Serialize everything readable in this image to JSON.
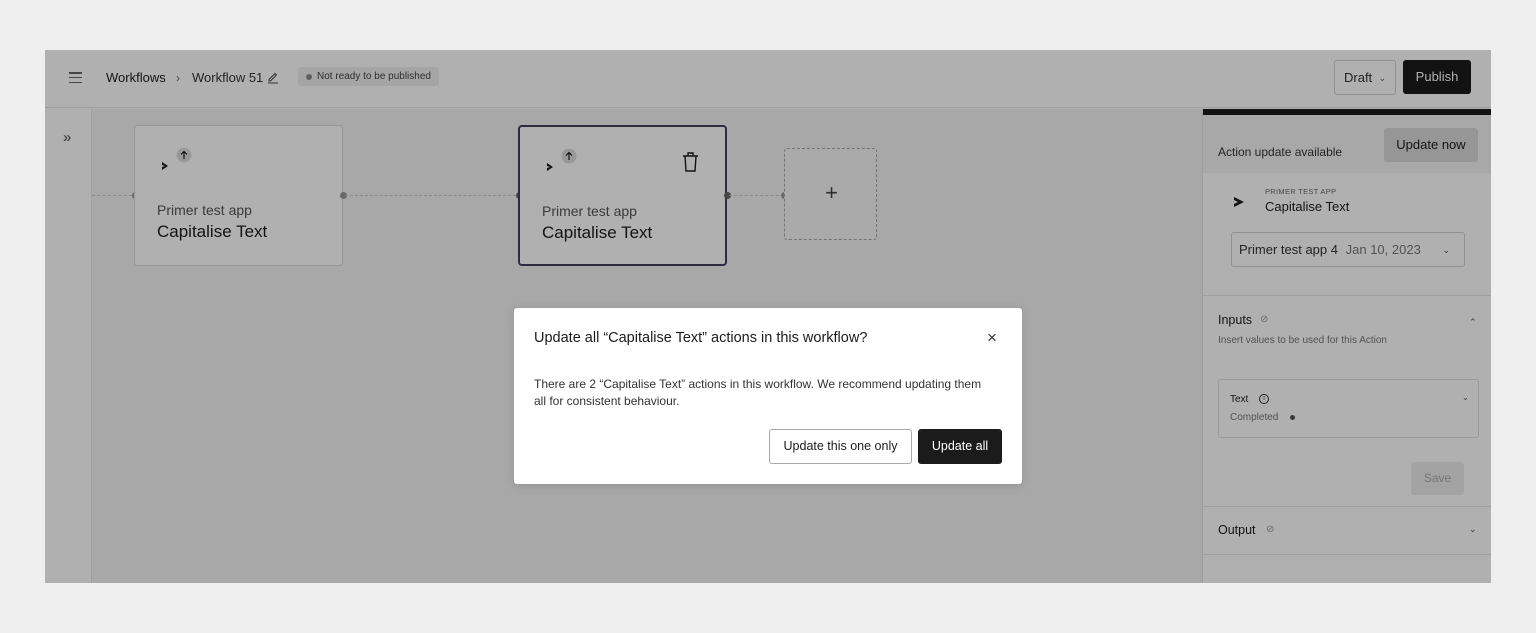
{
  "header": {
    "breadcrumb_root": "Workflows",
    "breadcrumb_separator": "›",
    "breadcrumb_current": "Workflow 51",
    "status": "Not ready to be published",
    "version_select": "Draft",
    "publish_label": "Publish"
  },
  "rail": {
    "expand_glyph": "»"
  },
  "canvas": {
    "nodes": [
      {
        "app": "Primer test app",
        "title": "Capitalise Text",
        "selected": false
      },
      {
        "app": "Primer test app",
        "title": "Capitalise Text",
        "selected": true
      }
    ],
    "add_glyph": "+"
  },
  "panel": {
    "update_available_label": "Action update available",
    "update_now_label": "Update now",
    "app_caption": "PRIMER TEST APP",
    "action_title": "Capitalise Text",
    "version_name": "Primer test app 4",
    "version_date": "Jan 10, 2023",
    "inputs_title": "Inputs",
    "inputs_subtitle": "Insert values to be used for this Action",
    "text_field_label": "Text",
    "text_field_status": "Completed",
    "save_label": "Save",
    "output_title": "Output"
  },
  "dialog": {
    "title": "Update all “Capitalise Text” actions in this workflow?",
    "close_glyph": "×",
    "body": "There are 2 “Capitalise Text” actions in this workflow. We recommend updating them all for consistent behaviour.",
    "secondary_label": "Update this one only",
    "primary_label": "Update all"
  },
  "colors": {
    "primary_dark": "#1b1b1b",
    "selected_node_border": "#44405c",
    "overlay": "rgba(0,0,0,0.31)"
  },
  "icons": [
    "menu-icon",
    "pencil-icon",
    "expand-icon",
    "app-logo-icon",
    "update-arrow-icon",
    "trash-icon",
    "plus-icon",
    "chevron-down-icon",
    "chevron-up-icon",
    "check-circle-icon",
    "info-icon",
    "close-icon"
  ]
}
